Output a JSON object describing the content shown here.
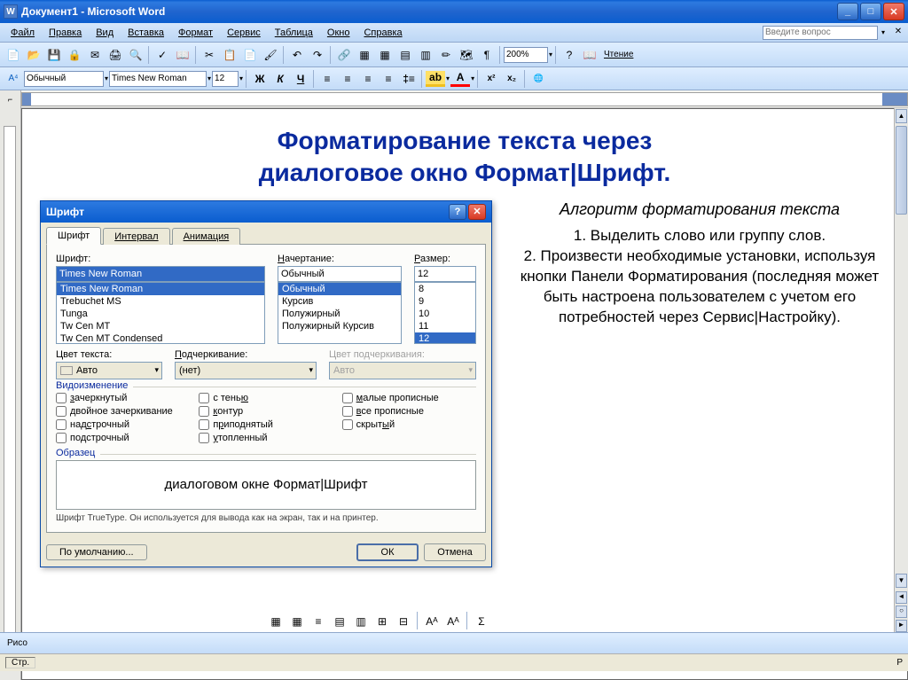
{
  "titlebar": {
    "title": "Документ1 - Microsoft Word"
  },
  "menu": {
    "items": [
      "Файл",
      "Правка",
      "Вид",
      "Вставка",
      "Формат",
      "Сервис",
      "Таблица",
      "Окно",
      "Справка"
    ],
    "help_placeholder": "Введите вопрос"
  },
  "toolbar": {
    "zoom": "200%",
    "read_label": "Чтение"
  },
  "format": {
    "style": "Обычный",
    "font": "Times New Roman",
    "size": "12"
  },
  "document": {
    "heading_line1": "Форматирование текста через",
    "heading_line2": "диалоговое окно Формат|Шрифт.",
    "algo_title": "Алгоритм форматирования текста",
    "algo_body": "1. Выделить слово или группу слов.\n2. Произвести необходимые установки, используя кнопки Панели Форматирования (последняя может быть настроена пользователем с учетом его потребностей через Сервис|Настройку)."
  },
  "dialog": {
    "title": "Шрифт",
    "tabs": [
      "Шрифт",
      "Интервал",
      "Анимация"
    ],
    "labels": {
      "font": "Шрифт:",
      "style": "Начертание:",
      "size": "Размер:",
      "color": "Цвет текста:",
      "underline": "Подчеркивание:",
      "ul_color": "Цвет подчеркивания:",
      "effects": "Видоизменение",
      "preview": "Образец"
    },
    "font_value": "Times New Roman",
    "font_list": [
      "Times New Roman",
      "Trebuchet MS",
      "Tunga",
      "Tw Cen MT",
      "Tw Cen MT Condensed"
    ],
    "style_value": "Обычный",
    "style_list": [
      "Обычный",
      "Курсив",
      "Полужирный",
      "Полужирный Курсив"
    ],
    "size_value": "12",
    "size_list": [
      "8",
      "9",
      "10",
      "11",
      "12"
    ],
    "color_value": "Авто",
    "underline_value": "(нет)",
    "ul_color_value": "Авто",
    "effects": {
      "col1": [
        "зачеркнутый",
        "двойное зачеркивание",
        "надстрочный",
        "подстрочный"
      ],
      "col2": [
        "с тенью",
        "контур",
        "приподнятый",
        "утопленный"
      ],
      "col3": [
        "малые прописные",
        "все прописные",
        "скрытый"
      ]
    },
    "preview_text": "диалоговом окне Формат|Шрифт",
    "preview_hint": "Шрифт TrueType. Он используется для вывода как на экран, так и на принтер.",
    "buttons": {
      "default": "По умолчанию...",
      "ok": "ОК",
      "cancel": "Отмена"
    }
  },
  "drawbar": {
    "label": "Рисо"
  },
  "statusbar": {
    "page": "Стр."
  }
}
